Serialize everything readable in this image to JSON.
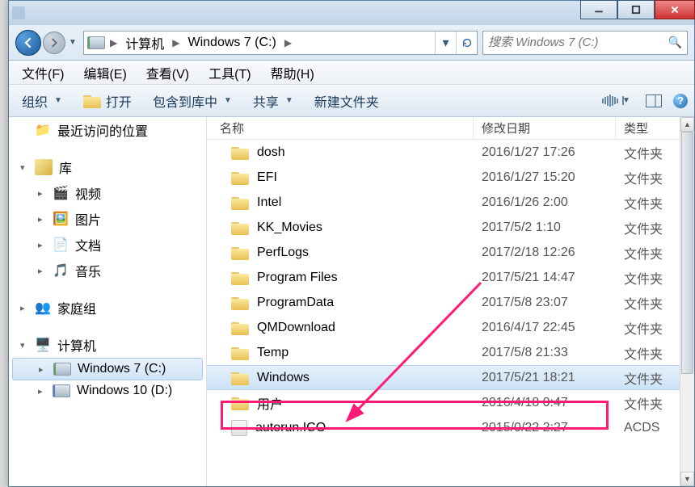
{
  "breadcrumbs": [
    "计算机",
    "Windows 7 (C:)"
  ],
  "search": {
    "placeholder": "搜索 Windows 7 (C:)"
  },
  "menubar": [
    "文件(F)",
    "编辑(E)",
    "查看(V)",
    "工具(T)",
    "帮助(H)"
  ],
  "toolbar": {
    "organize": "组织",
    "open": "打开",
    "include": "包含到库中",
    "share": "共享",
    "newfolder": "新建文件夹"
  },
  "sidebar": {
    "recent": "最近访问的位置",
    "libraries": "库",
    "lib_items": [
      "视频",
      "图片",
      "文档",
      "音乐"
    ],
    "homegroup": "家庭组",
    "computer": "计算机",
    "drive_c": "Windows 7 (C:)",
    "drive_d": "Windows 10 (D:)"
  },
  "columns": {
    "name": "名称",
    "date": "修改日期",
    "type": "类型"
  },
  "rows": [
    {
      "name": "dosh",
      "date": "2016/1/27 17:26",
      "type": "文件夹"
    },
    {
      "name": "EFI",
      "date": "2016/1/27 15:20",
      "type": "文件夹"
    },
    {
      "name": "Intel",
      "date": "2016/1/26 2:00",
      "type": "文件夹"
    },
    {
      "name": "KK_Movies",
      "date": "2017/5/2 1:10",
      "type": "文件夹"
    },
    {
      "name": "PerfLogs",
      "date": "2017/2/18 12:26",
      "type": "文件夹"
    },
    {
      "name": "Program Files",
      "date": "2017/5/21 14:47",
      "type": "文件夹"
    },
    {
      "name": "ProgramData",
      "date": "2017/5/8 23:07",
      "type": "文件夹"
    },
    {
      "name": "QMDownload",
      "date": "2016/4/17 22:45",
      "type": "文件夹"
    },
    {
      "name": "Temp",
      "date": "2017/5/8 21:33",
      "type": "文件夹"
    },
    {
      "name": "Windows",
      "date": "2017/5/21 18:21",
      "type": "文件夹",
      "selected": true
    },
    {
      "name": "用户",
      "date": "2016/4/18 0:47",
      "type": "文件夹"
    },
    {
      "name": "autorun.ICO",
      "date": "2015/0/22 2:27",
      "type": "ACDS",
      "icon": "file"
    }
  ]
}
